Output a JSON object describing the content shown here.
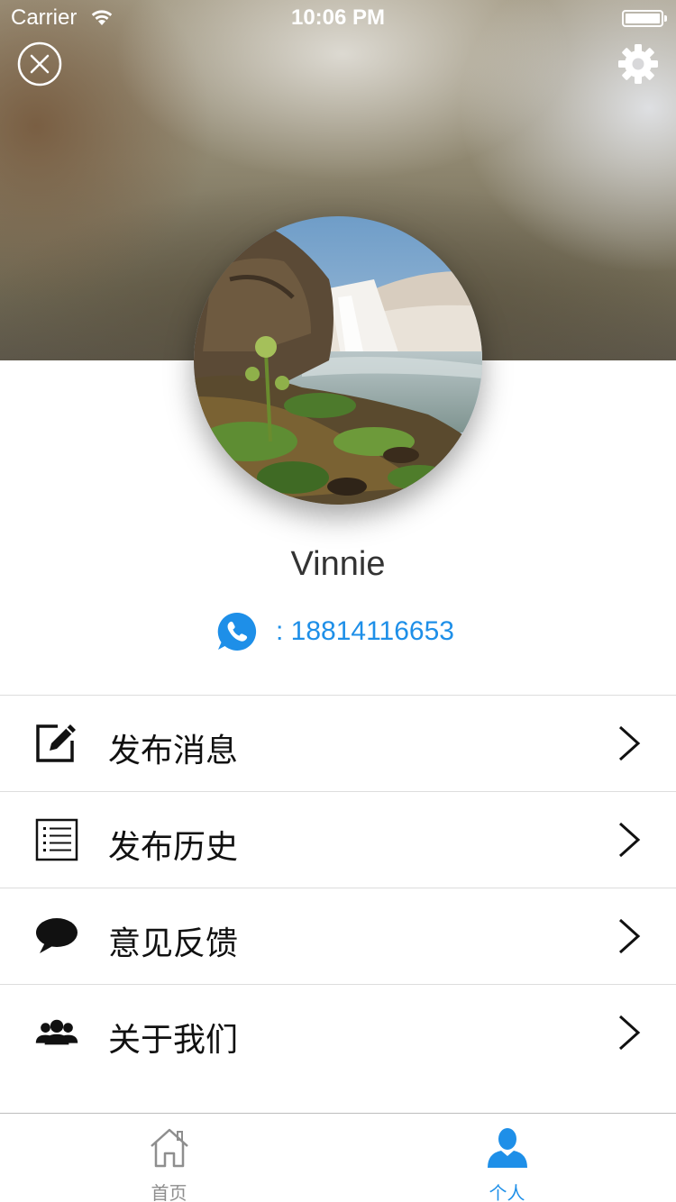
{
  "status_bar": {
    "carrier": "Carrier",
    "time": "10:06 PM"
  },
  "header": {
    "close_icon": "close-circle-icon",
    "settings_icon": "gear-icon"
  },
  "profile": {
    "name": "Vinnie",
    "phone": ": 18814116653",
    "phone_icon": "phone-bubble-icon",
    "accent_color": "#1e8fe8"
  },
  "menu": [
    {
      "label": "发布消息",
      "icon": "edit-icon"
    },
    {
      "label": "发布历史",
      "icon": "list-icon"
    },
    {
      "label": "意见反馈",
      "icon": "chat-bubble-icon"
    },
    {
      "label": "关于我们",
      "icon": "group-icon"
    }
  ],
  "tabbar": {
    "items": [
      {
        "label": "首页",
        "icon": "home-icon",
        "active": false
      },
      {
        "label": "个人",
        "icon": "person-icon",
        "active": true
      }
    ]
  }
}
